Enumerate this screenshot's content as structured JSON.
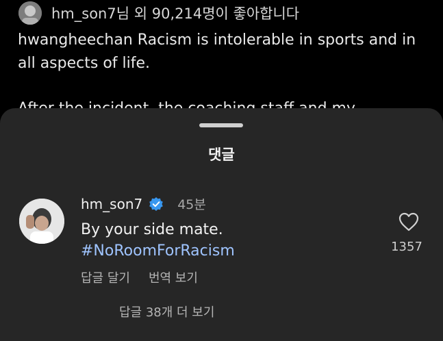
{
  "post": {
    "liked_by": "hm_son7님 외 90,214명이 좋아합니다",
    "caption": "hwangheechan Racism is intolerable in sports and in all aspects of life.",
    "caption_cut": "After the incident, the coaching staff and my"
  },
  "comments_sheet": {
    "title": "댓글",
    "comment": {
      "username": "hm_son7",
      "verified": true,
      "time": "45분",
      "text": "By your side mate.",
      "hashtag": "#NoRoomForRacism",
      "reply_label": "답글 달기",
      "translate_label": "번역 보기",
      "like_count": "1357",
      "icon": "heart-outline-icon"
    },
    "more_replies": "답글 38개 더 보기"
  },
  "colors": {
    "background": "#000000",
    "sheet": "#262626",
    "hashtag": "#9fc4ff",
    "verified": "#3897f0"
  }
}
